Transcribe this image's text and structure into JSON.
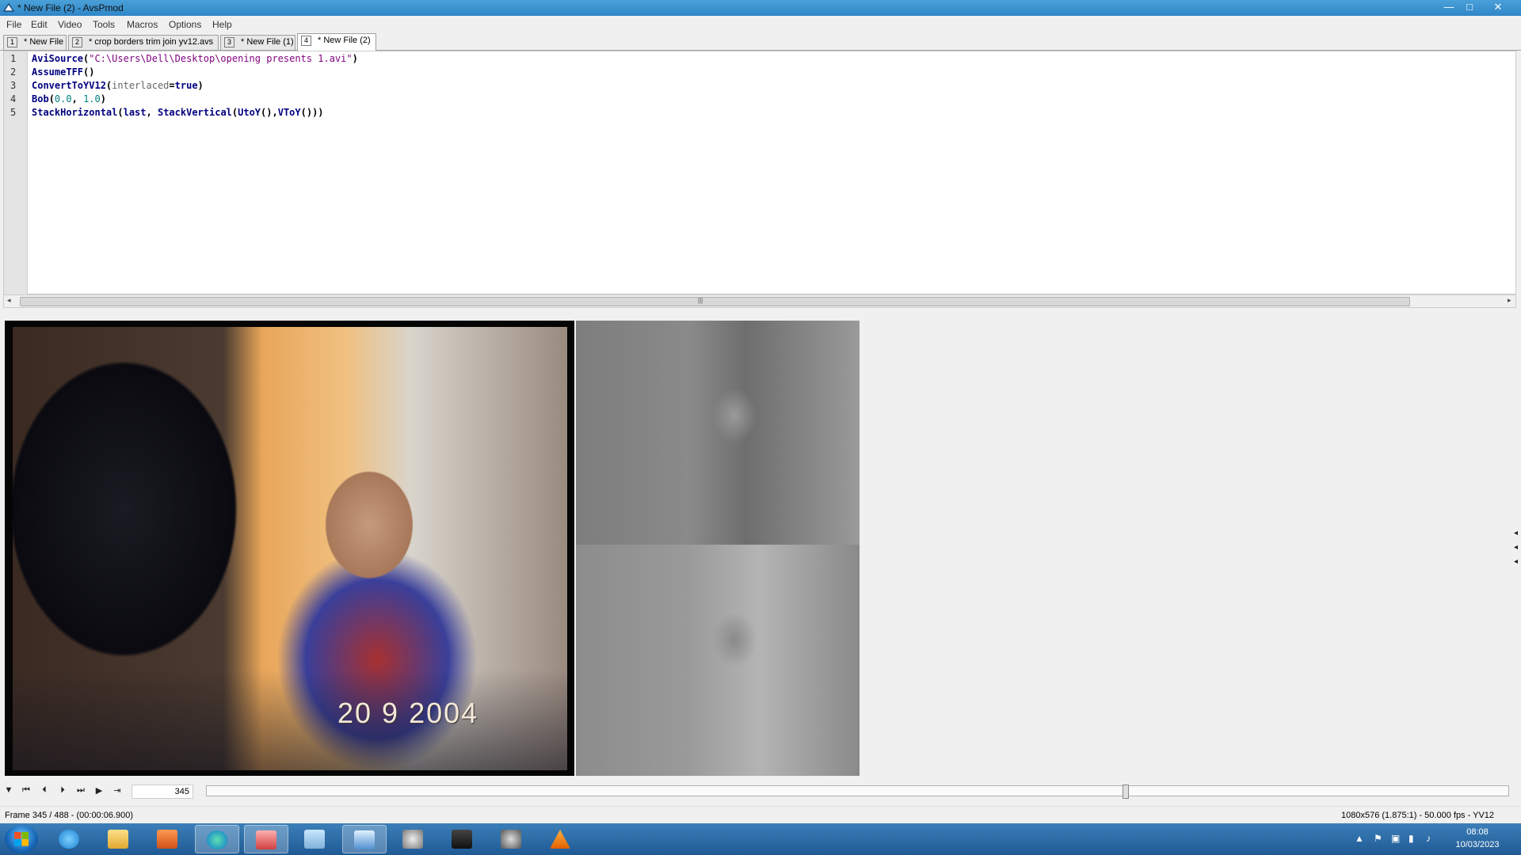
{
  "window": {
    "title": "* New File (2) - AvsPmod",
    "minimize": "—",
    "maximize": "□",
    "close": "✕"
  },
  "menu": [
    "File",
    "Edit",
    "Video",
    "Tools",
    "Macros",
    "Options",
    "Help"
  ],
  "tabs": [
    {
      "num": "1",
      "label": "* New File",
      "active": false
    },
    {
      "num": "2",
      "label": "* crop borders trim join yv12.avs",
      "active": false
    },
    {
      "num": "3",
      "label": "* New File (1)",
      "active": false
    },
    {
      "num": "4",
      "label": "* New File (2)",
      "active": true
    }
  ],
  "editor": {
    "line_numbers": [
      "1",
      "2",
      "3",
      "4",
      "5"
    ],
    "lines": [
      {
        "fn": "AviSource",
        "open": "(",
        "str": "\"C:\\Users\\Dell\\Desktop\\opening presents 1.avi\"",
        "close": ")"
      },
      {
        "fn": "AssumeTFF",
        "open": "()"
      },
      {
        "fn": "ConvertToYV12",
        "open": "(",
        "arg": "interlaced",
        "eq": "=",
        "kw": "true",
        "close": ")"
      },
      {
        "fn": "Bob",
        "open": "(",
        "n1": "0.0",
        "sep": ", ",
        "n2": "1.0",
        "close": ")"
      },
      {
        "fn": "StackHorizontal",
        "open": "(",
        "kw": "last",
        "sep": ", ",
        "fn2": "StackVertical",
        "open2": "(",
        "fn3": "UtoY",
        "p3": "(),",
        "fn4": "VToY",
        "close": "()))"
      }
    ]
  },
  "video": {
    "date_stamp": "20  9 2004"
  },
  "controls": {
    "frame_value": "345",
    "seek_position": 0.7069,
    "buttons": [
      "menu-triangle",
      "go-start",
      "prev-frame",
      "next-frame",
      "go-end",
      "play",
      "jump"
    ]
  },
  "status": {
    "left": "Frame 345 / 488  -  (00:00:06.900)",
    "right": "1080x576 (1.875:1)  -  50.000 fps  -  YV12"
  },
  "taskbar": {
    "apps": [
      "internet-explorer",
      "file-explorer",
      "media-player",
      "edge",
      "paint",
      "notepad",
      "avspmod",
      "settings-gear",
      "video-editor",
      "control-panel",
      "vlc"
    ],
    "clock_time": "08:08",
    "clock_date": "10/03/2023"
  },
  "colors": {
    "titlebar": "#2f86c7",
    "taskbar": "#1f5a95",
    "function": "#00007f",
    "string": "#7f007f",
    "number": "#007f7f"
  }
}
